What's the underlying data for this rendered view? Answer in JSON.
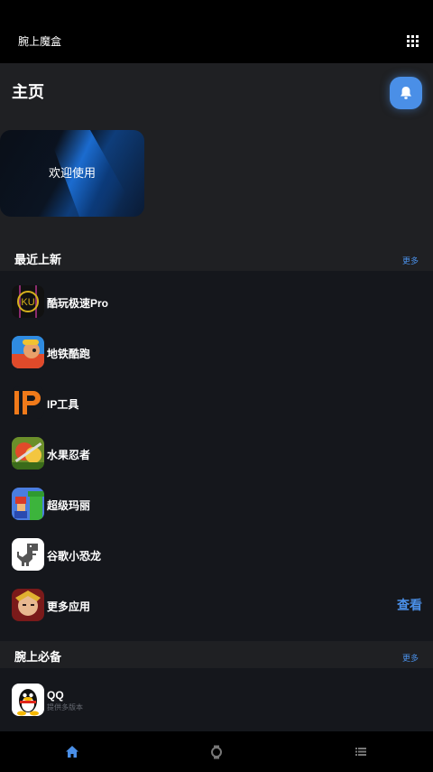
{
  "app": {
    "title": "腕上魔盒"
  },
  "home": {
    "title": "主页"
  },
  "banner": {
    "text": "欢迎使用"
  },
  "recent": {
    "title": "最近上新",
    "more": "更多",
    "items": [
      {
        "name": "酷玩极速Pro",
        "icon": "kuwan-app-icon"
      },
      {
        "name": "地铁酷跑",
        "icon": "subway-surfers-app-icon"
      },
      {
        "name": "IP工具",
        "icon": "ip-tool-app-icon"
      },
      {
        "name": "水果忍者",
        "icon": "fruit-ninja-app-icon"
      },
      {
        "name": "超级玛丽",
        "icon": "super-mario-app-icon"
      },
      {
        "name": "谷歌小恐龙",
        "icon": "dino-app-icon"
      },
      {
        "name": "更多应用",
        "icon": "more-apps-icon",
        "action": "查看"
      }
    ]
  },
  "essentials": {
    "title": "腕上必备",
    "more": "更多",
    "items": [
      {
        "name": "QQ",
        "subtitle": "提供多版本",
        "icon": "qq-app-icon"
      }
    ]
  },
  "nav": {
    "tabs": [
      {
        "icon": "home-icon",
        "active": true
      },
      {
        "icon": "watch-icon",
        "active": false
      },
      {
        "icon": "list-icon",
        "active": false
      }
    ]
  },
  "colors": {
    "accent": "#4a8fe7",
    "background": "#1f2023",
    "panel": "#15171c",
    "bar": "#000000"
  }
}
